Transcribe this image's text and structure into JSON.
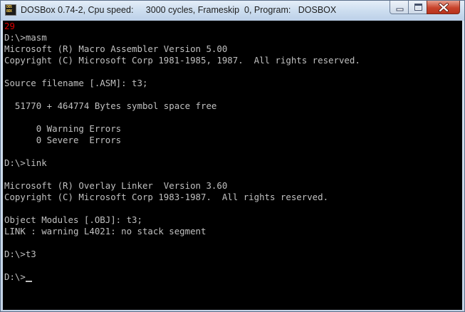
{
  "window": {
    "title": "DOSBox 0.74-2, Cpu speed:     3000 cycles, Frameskip  0, Program:   DOSBOX",
    "icon": "dosbox-icon",
    "icon_label_top": "DOS",
    "icon_label_bottom": "BOX",
    "buttons": {
      "minimize": "minimize-icon",
      "maximize": "maximize-icon",
      "close": "close-icon"
    }
  },
  "console": {
    "colors": {
      "background": "#000000",
      "text": "#c0c0c0",
      "counter": "#d80000"
    },
    "lines": [
      "29",
      "D:\\>masm",
      "Microsoft (R) Macro Assembler Version 5.00",
      "Copyright (C) Microsoft Corp 1981-1985, 1987.  All rights reserved.",
      "",
      "Source filename [.ASM]: t3;",
      "",
      "  51770 + 464774 Bytes symbol space free",
      "",
      "      0 Warning Errors",
      "      0 Severe  Errors",
      "",
      "D:\\>link",
      "",
      "Microsoft (R) Overlay Linker  Version 3.60",
      "Copyright (C) Microsoft Corp 1983-1987.  All rights reserved.",
      "",
      "Object Modules [.OBJ]: t3;",
      "LINK : warning L4021: no stack segment",
      "",
      "D:\\>t3",
      "",
      "D:\\>"
    ]
  }
}
